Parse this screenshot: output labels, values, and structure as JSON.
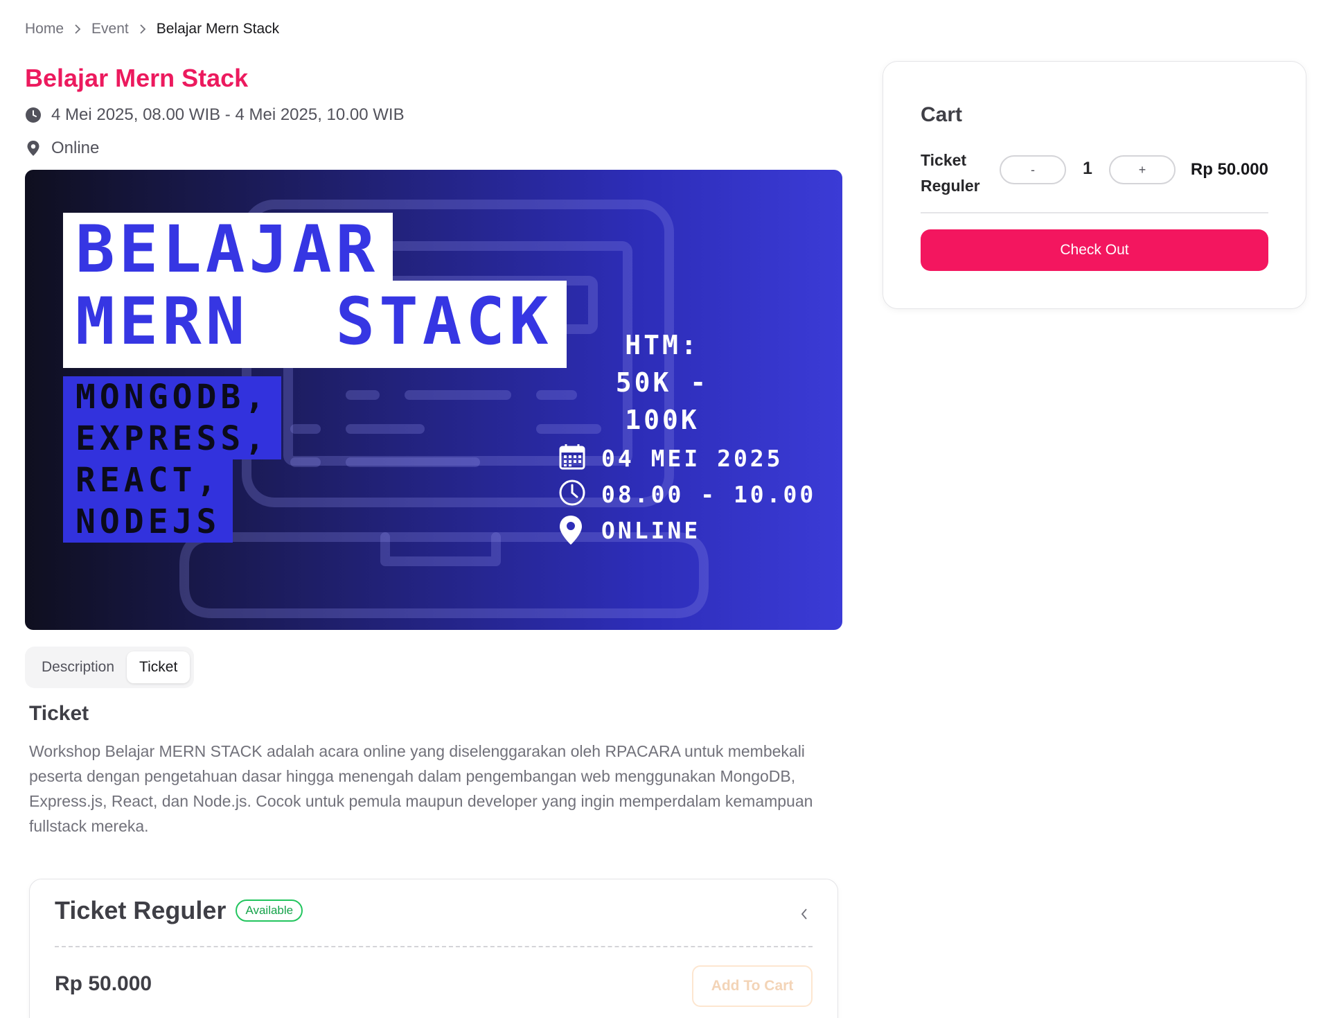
{
  "breadcrumb": {
    "items": [
      "Home",
      "Event",
      "Belajar Mern Stack"
    ]
  },
  "event": {
    "title": "Belajar Mern Stack",
    "datetime": "4 Mei 2025, 08.00 WIB - 4 Mei 2025, 10.00 WIB",
    "location": "Online"
  },
  "banner": {
    "title_line1": "BELAJAR",
    "title_line2": "MERN  STACK",
    "stack_lines": [
      "MONGODB,",
      "EXPRESS,",
      "REACT,",
      "NODEJS"
    ],
    "htm_label": "HTM:",
    "htm_value": "50K - 100K",
    "date": "04 MEI 2025",
    "time": "08.00 - 10.00",
    "venue": "ONLINE"
  },
  "tabs": {
    "items": [
      "Description",
      "Ticket"
    ],
    "active": "Ticket"
  },
  "section": {
    "heading": "Ticket",
    "description": "Workshop Belajar MERN STACK adalah acara online yang diselenggarakan oleh RPACARA untuk membekali peserta dengan pengetahuan dasar hingga menengah dalam pengembangan web menggunakan MongoDB, Express.js, React, dan Node.js. Cocok untuk pemula maupun developer yang ingin memperdalam kemampuan fullstack mereka."
  },
  "ticket_card": {
    "name": "Ticket Reguler",
    "status": "Available",
    "price": "Rp 50.000",
    "add_label": "Add To Cart"
  },
  "cart": {
    "title": "Cart",
    "item_name": "Ticket Reguler",
    "minus_label": "-",
    "plus_label": "+",
    "quantity": "1",
    "price": "Rp 50.000",
    "checkout_label": "Check Out"
  },
  "colors": {
    "accent": "#ec1a5e",
    "checkout": "#f3165f",
    "banner_blue": "#3636e3",
    "available": "#22c55e"
  },
  "icons": {
    "breadcrumb_sep": "chevron-right-icon",
    "date": "clock-icon",
    "location": "map-pin-icon",
    "collapse": "chevron-left-icon"
  }
}
